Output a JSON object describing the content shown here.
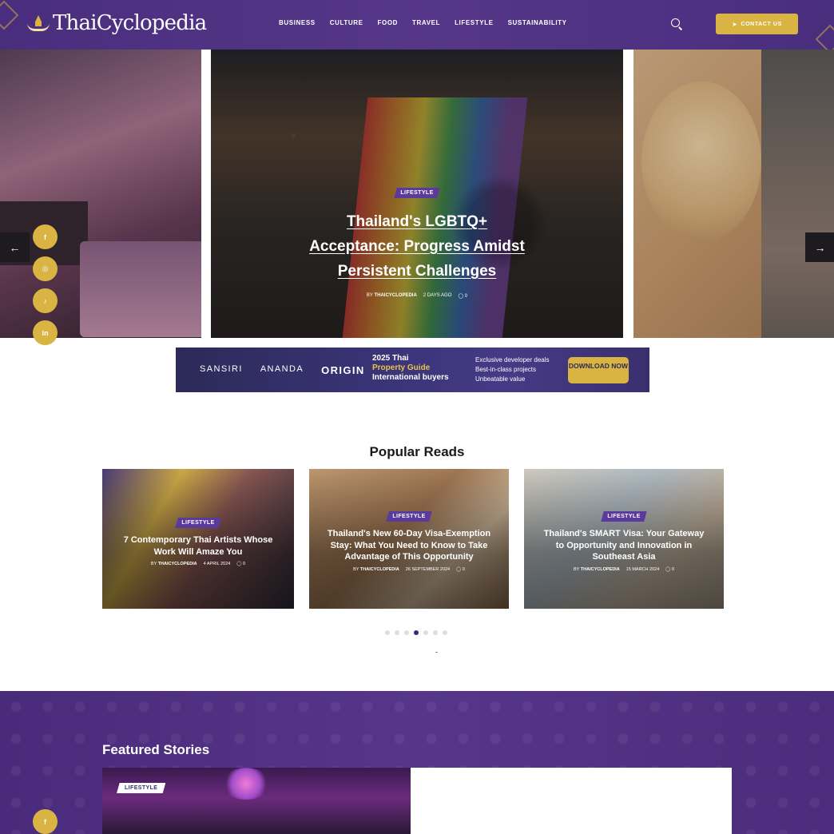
{
  "header": {
    "logo_text": "ThaiCyclopedia",
    "nav": [
      "BUSINESS",
      "CULTURE",
      "FOOD",
      "TRAVEL",
      "LIFESTYLE",
      "SUSTAINABILITY"
    ],
    "contact_label": "CONTACT US",
    "colors": {
      "header_bg": "#4f3284",
      "accent": "#d9b443"
    }
  },
  "hero": {
    "category": "LIFESTYLE",
    "title": "Thailand's LGBTQ+ Acceptance: Progress Amidst Persistent Challenges",
    "by_prefix": "BY",
    "author": "THAICYCLOPEDIA",
    "date": "2 DAYS AGO",
    "comments": "0",
    "prev_icon": "arrow-left-icon",
    "next_icon": "arrow-right-icon"
  },
  "social": {
    "facebook": "f",
    "instagram": "◎",
    "tiktok": "♪",
    "linkedin": "in"
  },
  "banner": {
    "brands": [
      "SANSIRI",
      "ANANDA",
      "ORIGIN"
    ],
    "guide_year": "2025 Thai",
    "guide_line2": "Property Guide",
    "guide_line3": "International buyers",
    "perk1": "Exclusive developer deals",
    "perk2": "Best-in-class projects",
    "perk3": "Unbeatable value",
    "button": "DOWNLOAD NOW"
  },
  "popular": {
    "title": "Popular Reads",
    "cards": [
      {
        "category": "LIFESTYLE",
        "title": "7 Contemporary Thai Artists Whose Work Will Amaze You",
        "by": "BY",
        "author": "THAICYCLOPEDIA",
        "date": "4 APRIL 2024",
        "comments": "0"
      },
      {
        "category": "LIFESTYLE",
        "title": "Thailand's New 60-Day Visa-Exemption Stay: What You Need to Know to Take Advantage of This Opportunity",
        "by": "BY",
        "author": "THAICYCLOPEDIA",
        "date": "26 SEPTEMBER 2024",
        "comments": "0"
      },
      {
        "category": "LIFESTYLE",
        "title": "Thailand's SMART Visa: Your Gateway to Opportunity and Innovation in Southeast Asia",
        "by": "BY",
        "author": "THAICYCLOPEDIA",
        "date": "15 MARCH 2024",
        "comments": "0"
      }
    ],
    "dots_total": 7,
    "dots_active": 4
  },
  "featured": {
    "title": "Featured Stories",
    "category": "LIFESTYLE"
  }
}
